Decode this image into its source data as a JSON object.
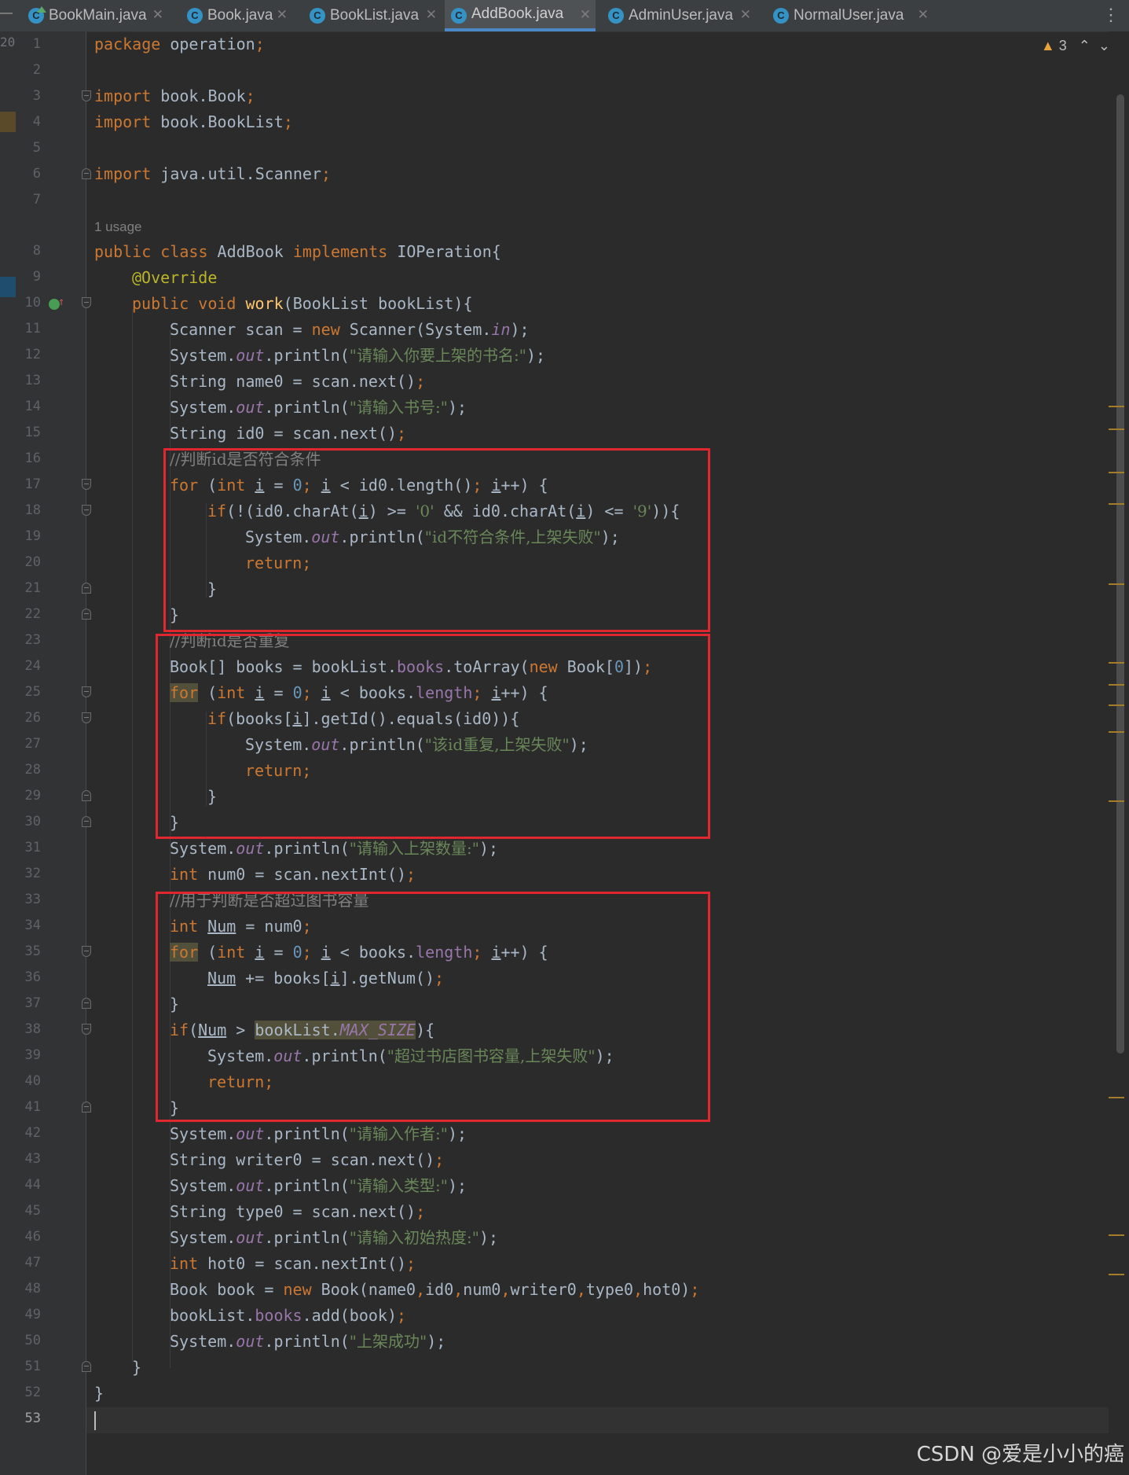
{
  "tabs": [
    {
      "label": "BookMain.java",
      "active": false
    },
    {
      "label": "Book.java",
      "active": false
    },
    {
      "label": "BookList.java",
      "active": false
    },
    {
      "label": "AddBook.java",
      "active": true
    },
    {
      "label": "AdminUser.java",
      "active": false
    },
    {
      "label": "NormalUser.java",
      "active": false
    }
  ],
  "tab_icon_letter": "C",
  "gutter_stub": "20",
  "inspection": {
    "warning_count": "3"
  },
  "usage_hint": "1 usage",
  "current_line": "53",
  "watermark": "CSDN @爱是小小的癌",
  "colors": {
    "keyword": "#cc7832",
    "string": "#6a8759",
    "number": "#6897bb",
    "field": "#9876aa",
    "method": "#ffc66d",
    "annotation": "#bbb529",
    "comment": "#808080",
    "highlight_box": "#e0262f"
  },
  "line_numbers": [
    "1",
    "2",
    "3",
    "4",
    "5",
    "6",
    "7",
    "8",
    "9",
    "10",
    "11",
    "12",
    "13",
    "14",
    "15",
    "16",
    "17",
    "18",
    "19",
    "20",
    "21",
    "22",
    "23",
    "24",
    "25",
    "26",
    "27",
    "28",
    "29",
    "30",
    "31",
    "32",
    "33",
    "34",
    "35",
    "36",
    "37",
    "38",
    "39",
    "40",
    "41",
    "42",
    "43",
    "44",
    "45",
    "46",
    "47",
    "48",
    "49",
    "50",
    "51",
    "52",
    "53"
  ],
  "code": {
    "l1": [
      "package",
      " operation",
      ";"
    ],
    "l3": [
      "import",
      " book.Book",
      ";"
    ],
    "l4": [
      "import",
      " book.BookList",
      ";"
    ],
    "l6": [
      "import",
      " java.util.Scanner",
      ";"
    ],
    "l8": [
      "public class",
      " AddBook ",
      "implements",
      " IOPeration{"
    ],
    "l9": [
      "@Override"
    ],
    "l10": [
      "public void",
      " ",
      "work",
      "(BookList bookList){"
    ],
    "l11": [
      "Scanner scan = ",
      "new",
      " Scanner(System.",
      "in",
      ");"
    ],
    "l12": [
      "System.",
      "out",
      ".println(",
      "\"请输入你要上架的书名:\"",
      ");"
    ],
    "l13": [
      "String name0 = scan.next()",
      ";"
    ],
    "l14": [
      "System.",
      "out",
      ".println(",
      "\"请输入书号:\"",
      ");"
    ],
    "l15": [
      "String id0 = scan.next()",
      ";"
    ],
    "l16": [
      "//判断id是否符合条件"
    ],
    "l17": [
      "for",
      " (",
      "int",
      " ",
      "i",
      " = ",
      "0",
      "; ",
      "i",
      " < id0.length()",
      "; ",
      "i",
      "++) {"
    ],
    "l18": [
      "if",
      "(!(id0.charAt(",
      "i",
      ") >= ",
      "'0'",
      " && id0.charAt(",
      "i",
      ") <= ",
      "'9'",
      ")){"
    ],
    "l19": [
      "System.",
      "out",
      ".println(",
      "\"id不符合条件,上架失败\"",
      ");"
    ],
    "l20": [
      "return",
      ";"
    ],
    "l21": [
      "}"
    ],
    "l22": [
      "}"
    ],
    "l23": [
      "//判断id是否重复"
    ],
    "l24": [
      "Book[] books = bookList.",
      "books",
      ".toArray(",
      "new",
      " Book[",
      "0",
      "])",
      ";"
    ],
    "l25": [
      "for",
      " (",
      "int",
      " ",
      "i",
      " = ",
      "0",
      "; ",
      "i",
      " < books.",
      "length",
      "; ",
      "i",
      "++) {"
    ],
    "l26": [
      "if",
      "(books[",
      "i",
      "].getId().equals(id0)){"
    ],
    "l27": [
      "System.",
      "out",
      ".println(",
      "\"该id重复,上架失败\"",
      ");"
    ],
    "l28": [
      "return",
      ";"
    ],
    "l29": [
      "}"
    ],
    "l30": [
      "}"
    ],
    "l31": [
      "System.",
      "out",
      ".println(",
      "\"请输入上架数量:\"",
      ");"
    ],
    "l32": [
      "int",
      " num0 = scan.nextInt()",
      ";"
    ],
    "l33": [
      "//用于判断是否超过图书容量"
    ],
    "l34": [
      "int",
      " ",
      "Num",
      " = num0",
      ";"
    ],
    "l35": [
      "for",
      " (",
      "int",
      " ",
      "i",
      " = ",
      "0",
      "; ",
      "i",
      " < books.",
      "length",
      "; ",
      "i",
      "++) {"
    ],
    "l36": [
      "Num",
      " += books[",
      "i",
      "].getNum()",
      ";"
    ],
    "l37": [
      "}"
    ],
    "l38": [
      "if",
      "(",
      "Num",
      " > ",
      "bookList.",
      "MAX_SIZE",
      "){"
    ],
    "l39": [
      "System.",
      "out",
      ".println(",
      "\"超过书店图书容量,上架失败\"",
      ");"
    ],
    "l40": [
      "return",
      ";"
    ],
    "l41": [
      "}"
    ],
    "l42": [
      "System.",
      "out",
      ".println(",
      "\"请输入作者:\"",
      ");"
    ],
    "l43": [
      "String writer0 = scan.next()",
      ";"
    ],
    "l44": [
      "System.",
      "out",
      ".println(",
      "\"请输入类型:\"",
      ");"
    ],
    "l45": [
      "String type0 = scan.next()",
      ";"
    ],
    "l46": [
      "System.",
      "out",
      ".println(",
      "\"请输入初始热度:\"",
      ");"
    ],
    "l47": [
      "int",
      " hot0 = scan.nextInt()",
      ";"
    ],
    "l48": [
      "Book book = ",
      "new",
      " Book(name0",
      ",",
      "id0",
      ",",
      "num0",
      ",",
      "writer0",
      ",",
      "type0",
      ",",
      "hot0)",
      ";"
    ],
    "l49": [
      "bookList.",
      "books",
      ".add(book)",
      ";"
    ],
    "l50": [
      "System.",
      "out",
      ".println(",
      "\"上架成功\"",
      ");"
    ],
    "l51": [
      "}"
    ],
    "l52": [
      "}"
    ]
  }
}
